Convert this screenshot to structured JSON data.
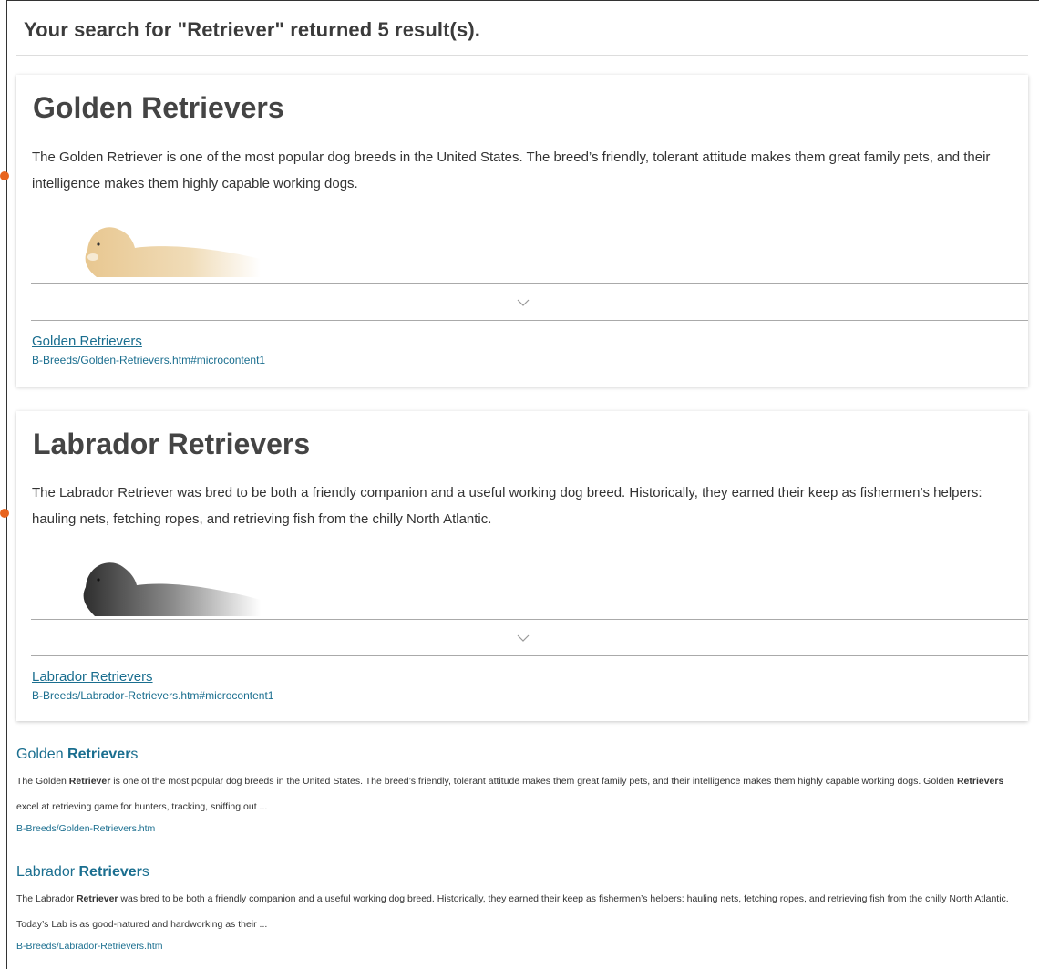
{
  "search": {
    "heading": "Your search for \"Retriever\" returned 5 result(s)."
  },
  "featured": [
    {
      "title": "Golden Retrievers",
      "description": "The Golden Retriever is one of the most popular dog breeds in the United States. The breed’s friendly, tolerant attitude makes them great family pets, and their intelligence makes them highly capable working dogs.",
      "link_text": "Golden Retrievers",
      "path": "B-Breeds/Golden-Retrievers.htm#microcontent1",
      "dog_color": "#e8c790"
    },
    {
      "title": "Labrador Retrievers",
      "description": "The Labrador Retriever was bred to be both a friendly companion and a useful working dog breed. Historically, they earned their keep as fishermen’s helpers: hauling nets, fetching ropes, and retrieving fish from the chilly North Atlantic.",
      "link_text": "Labrador Retrievers",
      "path": "B-Breeds/Labrador-Retrievers.htm#microcontent1",
      "dog_color": "#3a3a3a"
    }
  ],
  "results": [
    {
      "title_pre": "Golden ",
      "title_bold": "Retriever",
      "title_post": "s",
      "snippet_pre": "The Golden ",
      "snippet_bold1": "Retriever",
      "snippet_mid": " is one of the most popular dog breeds in the United States. The breed’s friendly, tolerant attitude makes them great family pets, and their intelligence makes them highly capable working dogs. Golden ",
      "snippet_bold2": "Retrievers",
      "snippet_post": " excel at retrieving game for hunters, tracking, sniffing out ...",
      "path": "B-Breeds/Golden-Retrievers.htm"
    },
    {
      "title_pre": "Labrador ",
      "title_bold": "Retriever",
      "title_post": "s",
      "snippet_pre": "The Labrador ",
      "snippet_bold1": "Retriever",
      "snippet_mid": " was bred to be both a friendly companion and a useful working dog breed. Historically, they earned their keep as fishermen’s helpers: hauling nets, fetching ropes, and retrieving fish from the chilly North Atlantic. Today’s Lab is as good-natured and hardworking as their ...",
      "snippet_bold2": "",
      "snippet_post": "",
      "path": "B-Breeds/Labrador-Retrievers.htm"
    }
  ],
  "icons": {
    "expand": "chevron-down-icon"
  }
}
